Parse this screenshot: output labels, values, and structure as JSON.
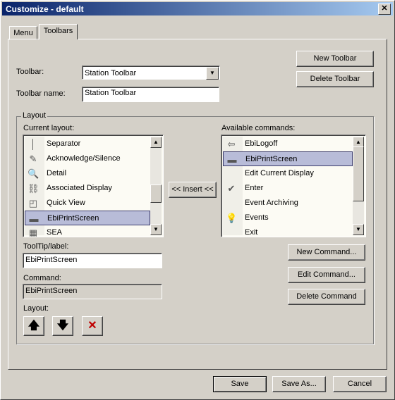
{
  "window": {
    "title": "Customize - default",
    "close_glyph": "✕"
  },
  "tabs": [
    {
      "label": "Menu"
    },
    {
      "label": "Toolbars"
    }
  ],
  "toolbar_field": {
    "label": "Toolbar:",
    "value": "Station Toolbar"
  },
  "toolbar_name": {
    "label": "Toolbar name:",
    "value": "Station Toolbar"
  },
  "buttons": {
    "new_toolbar": "New Toolbar",
    "delete_toolbar": "Delete Toolbar",
    "insert": "<< Insert <<",
    "new_command": "New Command...",
    "edit_command": "Edit Command...",
    "delete_command": "Delete Command",
    "save": "Save",
    "save_as": "Save As...",
    "cancel": "Cancel"
  },
  "layout_group": {
    "title": "Layout",
    "current_label": "Current layout:",
    "available_label": "Available commands:",
    "current_items": [
      {
        "label": "Separator",
        "icon": "separator-icon",
        "glyph": "│"
      },
      {
        "label": "Acknowledge/Silence",
        "icon": "acknowledge-icon",
        "glyph": "✎"
      },
      {
        "label": "Detail",
        "icon": "magnifier-icon",
        "glyph": "🔍"
      },
      {
        "label": "Associated Display",
        "icon": "link-icon",
        "glyph": "⛓"
      },
      {
        "label": "Quick View",
        "icon": "quick-view-icon",
        "glyph": "◰"
      },
      {
        "label": "EbiPrintScreen",
        "icon": "print-screen-icon",
        "glyph": "▬",
        "selected": true
      },
      {
        "label": "SEA",
        "icon": "sea-icon",
        "glyph": "▦"
      }
    ],
    "available_items": [
      {
        "label": "EbiLogoff",
        "icon": "logoff-icon",
        "glyph": "⇦"
      },
      {
        "label": "EbiPrintScreen",
        "icon": "print-screen-icon",
        "glyph": "▬",
        "selected": true
      },
      {
        "label": "Edit Current Display",
        "icon": "",
        "glyph": ""
      },
      {
        "label": "Enter",
        "icon": "checkmark-icon",
        "glyph": "✔"
      },
      {
        "label": "Event Archiving",
        "icon": "",
        "glyph": ""
      },
      {
        "label": "Events",
        "icon": "lightbulb-icon",
        "glyph": "💡"
      },
      {
        "label": "Exit",
        "icon": "",
        "glyph": ""
      }
    ],
    "tooltip_label": "ToolTip/label:",
    "tooltip_value": "EbiPrintScreen",
    "command_label": "Command:",
    "command_value": "EbiPrintScreen",
    "layout_label": "Layout:",
    "move_up_glyph": "🡅",
    "move_down_glyph": "🡇",
    "delete_glyph": "✕"
  },
  "colors": {
    "accent": "#0a246a",
    "selection": "#b8bcd8",
    "delete_red": "#c00000"
  }
}
